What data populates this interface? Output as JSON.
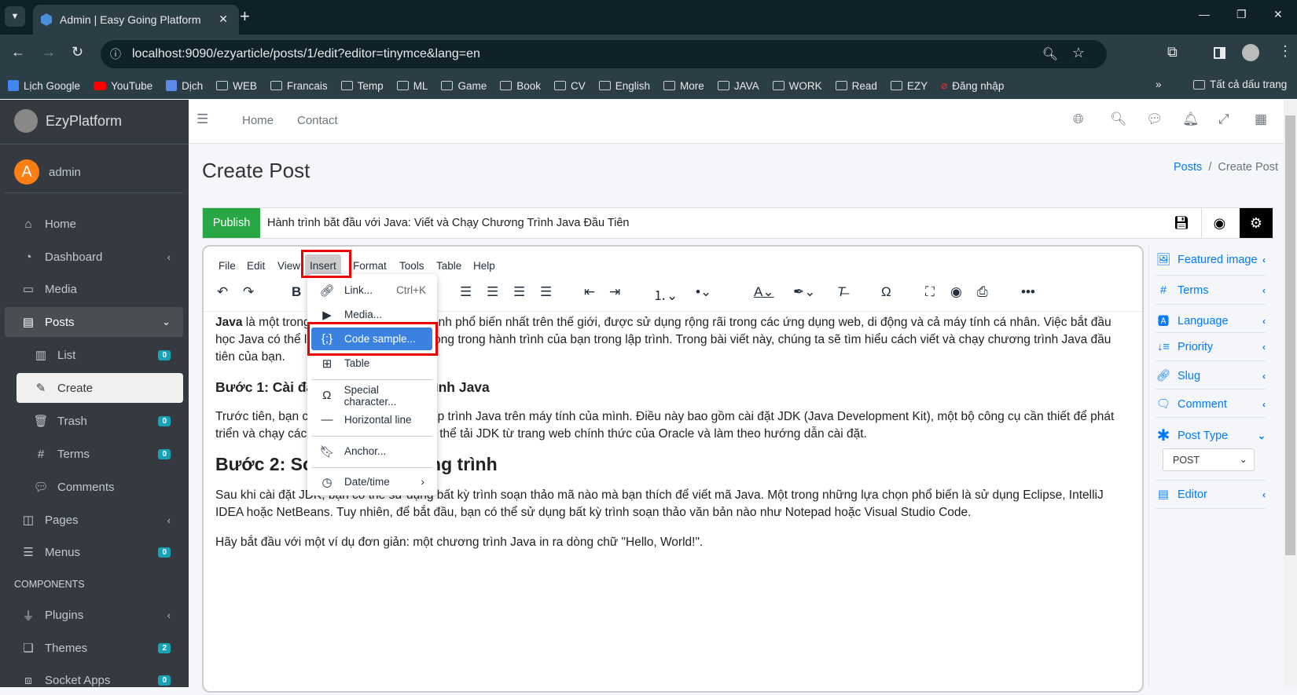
{
  "browser": {
    "tab_title": "Admin | Easy Going Platform",
    "url": "localhost:9090/ezyarticle/posts/1/edit?editor=tinymce&lang=en",
    "bookmarks": [
      "Lịch Google",
      "YouTube",
      "Dịch",
      "WEB",
      "Francais",
      "Temp",
      "ML",
      "Game",
      "Book",
      "CV",
      "English",
      "More",
      "JAVA",
      "WORK",
      "Read",
      "EZY",
      "Đăng nhập"
    ],
    "all_bookmarks": "Tất cả dấu trang"
  },
  "sidebar": {
    "brand": "EzyPlatform",
    "user": {
      "initial": "A",
      "name": "admin"
    },
    "items": [
      {
        "label": "Home"
      },
      {
        "label": "Dashboard"
      },
      {
        "label": "Media"
      },
      {
        "label": "Posts"
      },
      {
        "label": "List",
        "badge": "0"
      },
      {
        "label": "Create"
      },
      {
        "label": "Trash",
        "badge": "0"
      },
      {
        "label": "Terms",
        "badge": "0"
      },
      {
        "label": "Comments"
      },
      {
        "label": "Pages"
      },
      {
        "label": "Menus",
        "badge": "0"
      }
    ],
    "section": "COMPONENTS",
    "components": [
      {
        "label": "Plugins"
      },
      {
        "label": "Themes",
        "badge": "2"
      },
      {
        "label": "Socket Apps",
        "badge": "0"
      }
    ]
  },
  "topnav": {
    "links": [
      "Home",
      "Contact"
    ]
  },
  "page": {
    "title": "Create Post",
    "breadcrumb": [
      "Posts",
      "Create Post"
    ],
    "publish": "Publish",
    "post_title": "Hành trình bắt đầu với Java: Viết và Chạy Chương Trình Java Đầu Tiên"
  },
  "editor": {
    "menubar": [
      "File",
      "Edit",
      "View",
      "Insert",
      "Format",
      "Tools",
      "Table",
      "Help"
    ],
    "insert_menu": [
      {
        "label": "Link...",
        "shortcut": "Ctrl+K"
      },
      {
        "label": "Media..."
      },
      {
        "label": "Code sample..."
      },
      {
        "label": "Table"
      },
      {
        "label": "Special character..."
      },
      {
        "label": "Horizontal line"
      },
      {
        "label": "Anchor..."
      },
      {
        "label": "Date/time"
      }
    ],
    "content": {
      "p1_bold": "Java",
      "p1": " là một trong những ngôn ngữ lập trình phổ biến nhất trên thế giới, được sử dụng rộng rãi trong các ứng dụng web, di động và cả máy tính cá nhân. Việc bắt đầu học Java có thể là bước đầu tiên quan trọng trong hành trình của bạn trong lập trình. Trong bài viết này, chúng ta sẽ tìm hiểu cách viết và chạy chương trình Java đầu tiên của bạn.",
      "h3": "Bước 1: Cài đặt môi trường lập trình Java",
      "p2": "Trước tiên, bạn cần cài đặt môi trường lập trình Java trên máy tính của mình. Điều này bao gồm cài đặt JDK (Java Development Kit), một bộ công cụ cần thiết để phát triển và chạy các ứng dụng Java. Bạn có thể tải JDK từ trang web chính thức của Oracle và làm theo hướng dẫn cài đặt.",
      "h2": "Bước 2: Soạn thảo chương trình",
      "p3": "Sau khi cài đặt JDK, bạn có thể sử dụng bất kỳ trình soạn thảo mã nào mà bạn thích để viết mã Java. Một trong những lựa chọn phổ biến là sử dụng Eclipse, IntelliJ IDEA hoặc NetBeans. Tuy nhiên, để bắt đầu, bạn có thể sử dụng bất kỳ trình soạn thảo văn bản nào như Notepad hoặc Visual Studio Code.",
      "p4": "Hãy bắt đầu với một ví dụ đơn giản: một chương trình Java in ra dòng chữ \"Hello, World!\"."
    }
  },
  "right_panel": {
    "items": [
      "Featured image",
      "Terms",
      "Language",
      "Priority",
      "Slug",
      "Comment",
      "Post Type",
      "Editor"
    ],
    "post_type_value": "POST"
  },
  "colors": {
    "publish": "#28a745",
    "accent": "#007bff",
    "highlight": "#3b82e0",
    "annotation": "#e00000",
    "sidebar": "#343a40"
  }
}
